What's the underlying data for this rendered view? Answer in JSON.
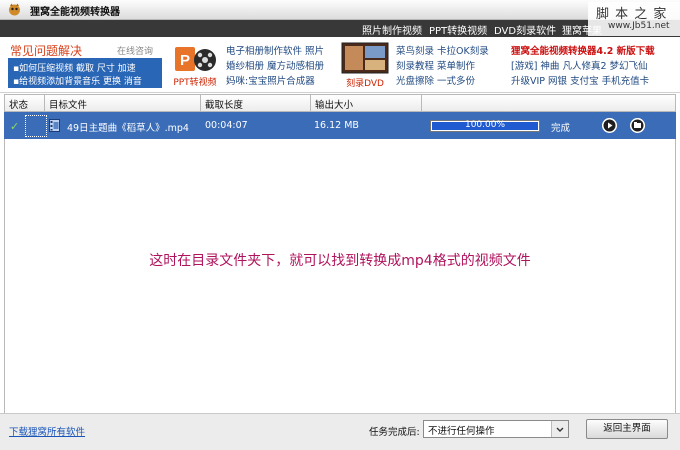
{
  "window": {
    "title": "狸窝全能视频转换器"
  },
  "menu": {
    "items": [
      "照片制作视频",
      "PPT转换视频",
      "DVD刻录软件",
      "狸窝苹果"
    ]
  },
  "watermark": {
    "text": "脚 本 之 家",
    "url": "www.Jb51.net"
  },
  "ads": {
    "faq_title": "常见问题解决",
    "faq_online": "在线咨询",
    "faq_lines": [
      "▪如何压缩视频  截取  尺寸  加速",
      "▪给视频添加背景音乐  更换  消音"
    ],
    "ppt_label": "PPT转视频",
    "ppt_links": [
      "电子相册制作软件  照片",
      "婚纱相册  魔方动感相册",
      "妈咪:宝宝照片合成器"
    ],
    "dvd_label": "刻录DVD",
    "dvd_links": [
      "菜鸟刻录  卡拉OK刻录",
      "刻录教程  菜单制作",
      "光盘擦除  一式多份"
    ],
    "right_links": [
      "狸窝全能视频转换器4.2  新版下载",
      "[游戏]  神曲  凡人修真2  梦幻飞仙",
      "升级VIP  网银  支付宝  手机充值卡"
    ],
    "colors": {
      "faq_bg": "#2a66b6",
      "faq_title": "#d8401a",
      "link": "#224b82"
    }
  },
  "table": {
    "headers": [
      "状态",
      "目标文件",
      "截取长度",
      "输出大小"
    ],
    "rows": [
      {
        "status": "✓",
        "file": "49日主题曲《稻草人》.mp4",
        "length": "00:04:07",
        "size": "16.12 MB",
        "progress_label": "100.00%",
        "progress": 1.0,
        "state": "完成"
      }
    ],
    "selected_color": "#3a6cb8"
  },
  "caption": "这时在目录文件夹下，就可以找到转换成mp4格式的视频文件",
  "footer": {
    "download_link": "下载狸窝所有软件",
    "task_label": "任务完成后:",
    "task_value": "不进行任何操作",
    "home_button": "返回主界面"
  }
}
